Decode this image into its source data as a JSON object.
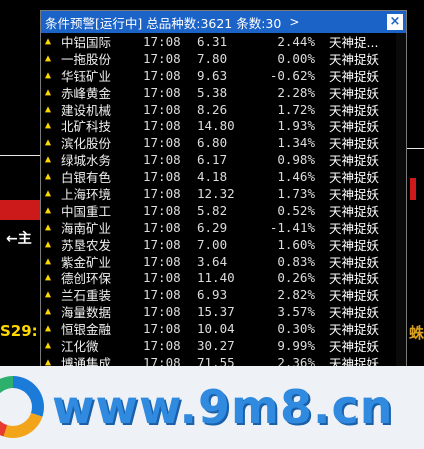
{
  "window": {
    "title": "条件预警[运行中] 总品种数:3621 条数:30",
    "title_arrow": ">",
    "close": "×"
  },
  "rows": [
    {
      "name": "中铝国际",
      "time": "17:08",
      "price": "6.31",
      "pct": "2.44%",
      "signal": "天神捉..."
    },
    {
      "name": "一拖股份",
      "time": "17:08",
      "price": "7.80",
      "pct": "0.00%",
      "signal": "天神捉妖"
    },
    {
      "name": "华钰矿业",
      "time": "17:08",
      "price": "9.63",
      "pct": "-0.62%",
      "signal": "天神捉妖"
    },
    {
      "name": "赤峰黄金",
      "time": "17:08",
      "price": "5.38",
      "pct": "2.28%",
      "signal": "天神捉妖"
    },
    {
      "name": "建设机械",
      "time": "17:08",
      "price": "8.26",
      "pct": "1.72%",
      "signal": "天神捉妖"
    },
    {
      "name": "北矿科技",
      "time": "17:08",
      "price": "14.80",
      "pct": "1.93%",
      "signal": "天神捉妖"
    },
    {
      "name": "滨化股份",
      "time": "17:08",
      "price": "6.80",
      "pct": "1.34%",
      "signal": "天神捉妖"
    },
    {
      "name": "绿城水务",
      "time": "17:08",
      "price": "6.17",
      "pct": "0.98%",
      "signal": "天神捉妖"
    },
    {
      "name": "白银有色",
      "time": "17:08",
      "price": "4.18",
      "pct": "1.46%",
      "signal": "天神捉妖"
    },
    {
      "name": "上海环境",
      "time": "17:08",
      "price": "12.32",
      "pct": "1.73%",
      "signal": "天神捉妖"
    },
    {
      "name": "中国重工",
      "time": "17:08",
      "price": "5.82",
      "pct": "0.52%",
      "signal": "天神捉妖"
    },
    {
      "name": "海南矿业",
      "time": "17:08",
      "price": "6.29",
      "pct": "-1.41%",
      "signal": "天神捉妖"
    },
    {
      "name": "苏垦农发",
      "time": "17:08",
      "price": "7.00",
      "pct": "1.60%",
      "signal": "天神捉妖"
    },
    {
      "name": "紫金矿业",
      "time": "17:08",
      "price": "3.64",
      "pct": "0.83%",
      "signal": "天神捉妖"
    },
    {
      "name": "德创环保",
      "time": "17:08",
      "price": "11.40",
      "pct": "0.26%",
      "signal": "天神捉妖"
    },
    {
      "name": "兰石重装",
      "time": "17:08",
      "price": "6.93",
      "pct": "2.82%",
      "signal": "天神捉妖"
    },
    {
      "name": "海量数据",
      "time": "17:08",
      "price": "15.37",
      "pct": "3.57%",
      "signal": "天神捉妖"
    },
    {
      "name": "恒银金融",
      "time": "17:08",
      "price": "10.04",
      "pct": "0.30%",
      "signal": "天神捉妖"
    },
    {
      "name": "江化微",
      "time": "17:08",
      "price": "30.27",
      "pct": "9.99%",
      "signal": "天神捉妖"
    },
    {
      "name": "博通集成",
      "time": "17:08",
      "price": "71.55",
      "pct": "2.36%",
      "signal": "天神捉妖"
    }
  ],
  "background": {
    "label_arrow": "←主",
    "label_code": "S29:",
    "label_right": "蛛"
  },
  "watermark": {
    "text": "www.9m8.cn"
  }
}
